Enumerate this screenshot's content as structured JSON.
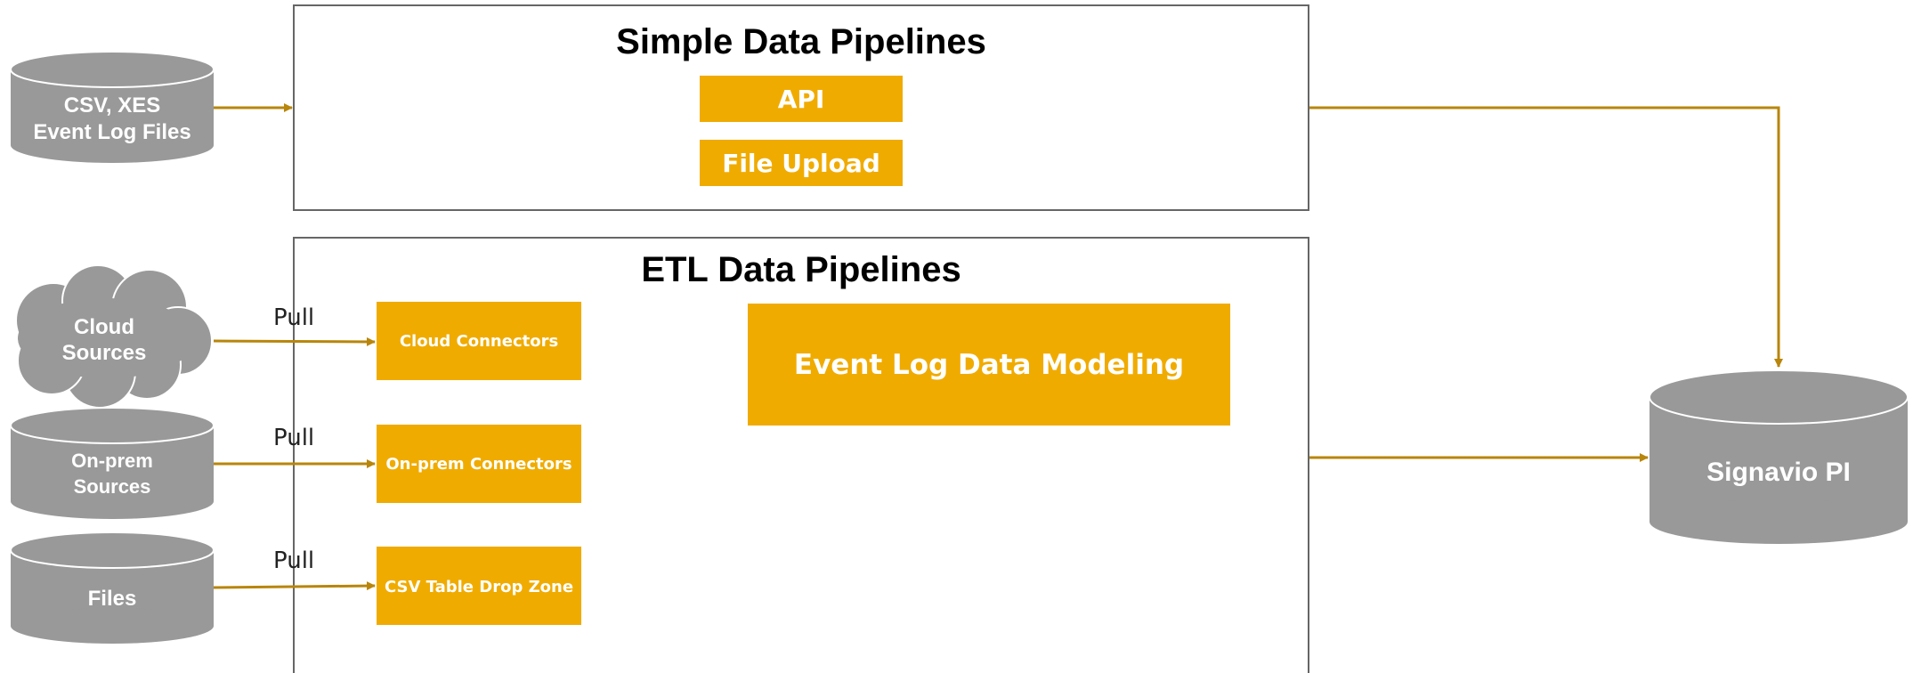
{
  "colors": {
    "accent": "#F0AB00",
    "arrow": "#B8860B",
    "source_gray": "#999999",
    "frame": "#666666"
  },
  "sources": {
    "event_log_files": {
      "line1": "CSV, XES",
      "line2": "Event Log Files"
    },
    "cloud": {
      "line1": "Cloud",
      "line2": "Sources"
    },
    "onprem": {
      "line1": "On-prem",
      "line2": "Sources"
    },
    "files": {
      "label": "Files"
    }
  },
  "simple_pipelines": {
    "title": "Simple Data Pipelines",
    "api_label": "API",
    "file_upload_label": "File Upload"
  },
  "etl_pipelines": {
    "title": "ETL Data Pipelines",
    "cloud_connectors": "Cloud Connectors",
    "onprem_connectors": "On-prem Connectors",
    "csv_drop_zone": "CSV Table Drop Zone",
    "event_log_modeling": "Event Log Data Modeling"
  },
  "pull_labels": [
    "Pull",
    "Pull",
    "Pull"
  ],
  "target": {
    "label": "Signavio PI"
  },
  "icons": [
    "database-icon",
    "cloud-icon",
    "arrow-right-icon",
    "arrow-down-icon"
  ]
}
